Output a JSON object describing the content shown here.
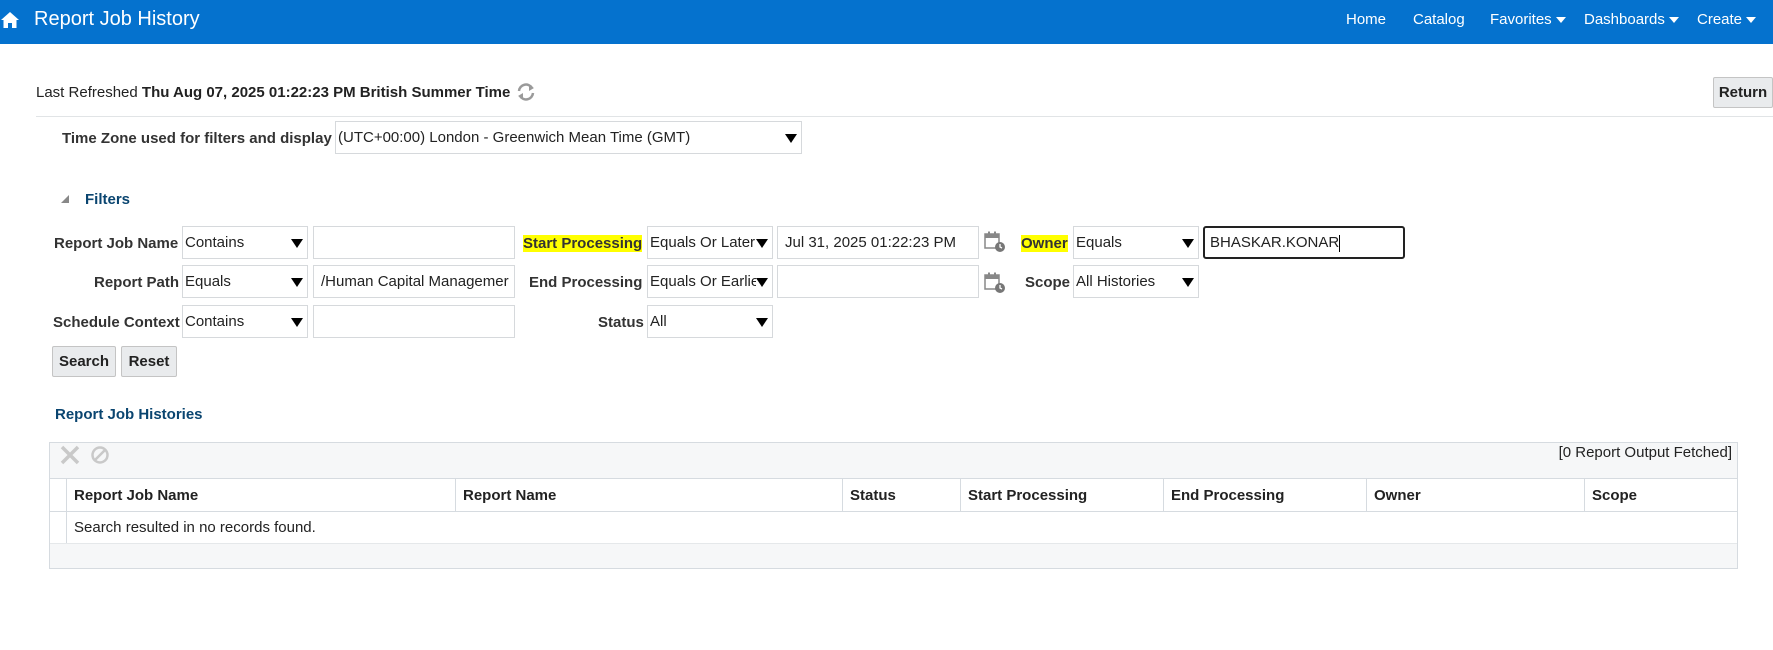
{
  "header": {
    "title": "Report Job History",
    "nav": [
      {
        "label": "Home",
        "has_caret": false
      },
      {
        "label": "Catalog",
        "has_caret": false
      },
      {
        "label": "Favorites",
        "has_caret": true
      },
      {
        "label": "Dashboards",
        "has_caret": true
      },
      {
        "label": "Create",
        "has_caret": true
      }
    ],
    "brand_color": "#0572ce"
  },
  "refresh": {
    "label": "Last Refreshed",
    "timestamp": "Thu Aug 07, 2025 01:22:23 PM British Summer Time",
    "icon": "refresh-icon"
  },
  "return_label": "Return",
  "timezone": {
    "label": "Time Zone used for filters and display",
    "value": "(UTC+00:00) London - Greenwich Mean Time (GMT)"
  },
  "filters": {
    "title": "Filters",
    "report_job_name": {
      "label": "Report Job Name",
      "operator": "Contains",
      "value": ""
    },
    "report_path": {
      "label": "Report Path",
      "operator": "Equals",
      "value": "/Human Capital Managemer"
    },
    "schedule_context": {
      "label": "Schedule Context",
      "operator": "Contains",
      "value": ""
    },
    "start_processing": {
      "label": "Start Processing",
      "operator": "Equals Or Later",
      "value": "Jul 31, 2025 01:22:23 PM"
    },
    "end_processing": {
      "label": "End Processing",
      "operator": "Equals Or Earlie",
      "value": ""
    },
    "status": {
      "label": "Status",
      "value": "All"
    },
    "owner": {
      "label": "Owner",
      "operator": "Equals",
      "value": "BHASKAR.KONAR"
    },
    "scope": {
      "label": "Scope",
      "value": "All Histories"
    },
    "search_label": "Search",
    "reset_label": "Reset",
    "highlight_color": "#ffff00"
  },
  "histories": {
    "title": "Report Job Histories",
    "fetched": "[0 Report Output Fetched]",
    "columns": [
      "Report Job Name",
      "Report Name",
      "Status",
      "Start Processing",
      "End Processing",
      "Owner",
      "Scope"
    ],
    "empty_message": "Search resulted in no records found."
  }
}
